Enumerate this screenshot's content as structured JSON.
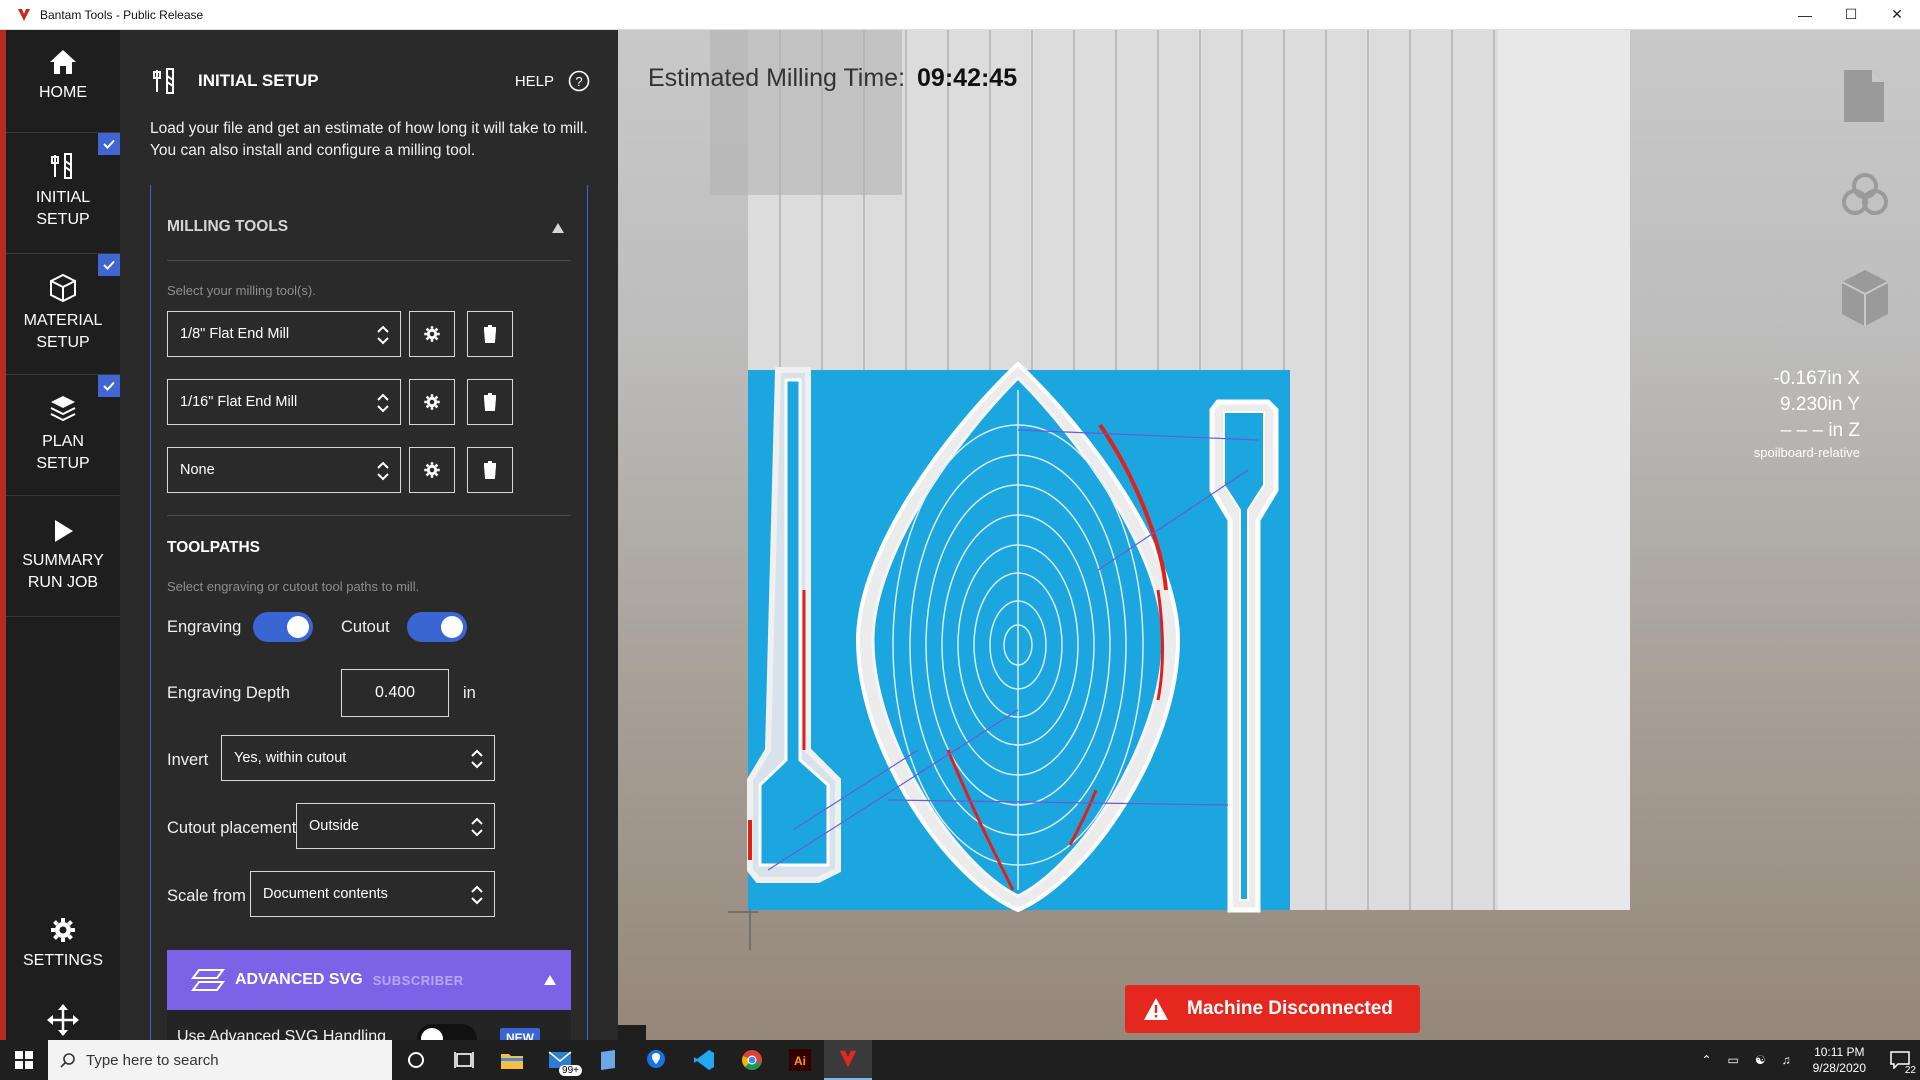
{
  "window": {
    "title": "Bantam Tools - Public Release"
  },
  "nav": {
    "home": "HOME",
    "initial_setup": [
      "INITIAL",
      "SETUP"
    ],
    "material_setup": [
      "MATERIAL",
      "SETUP"
    ],
    "plan_setup": [
      "PLAN",
      "SETUP"
    ],
    "summary": [
      "SUMMARY",
      "RUN JOB"
    ],
    "settings": "SETTINGS"
  },
  "panel": {
    "title": "INITIAL SETUP",
    "help": "HELP",
    "description": "Load your file and get an estimate of how long it will take to mill. You can also install and configure a milling tool.",
    "milling_tools": {
      "title": "MILLING TOOLS",
      "hint": "Select your milling tool(s).",
      "tools": [
        "1/8\" Flat End Mill",
        "1/16\" Flat End Mill",
        "None"
      ]
    },
    "toolpaths": {
      "title": "TOOLPATHS",
      "hint": "Select engraving or cutout tool paths to mill.",
      "engraving_label": "Engraving",
      "engraving_on": true,
      "cutout_label": "Cutout",
      "cutout_on": true,
      "depth_label": "Engraving Depth",
      "depth_value": "0.400",
      "depth_unit": "in",
      "invert_label": "Invert",
      "invert_value": "Yes, within cutout",
      "placement_label": "Cutout placement",
      "placement_value": "Outside",
      "scale_label": "Scale from",
      "scale_value": "Document contents"
    },
    "advanced_svg": {
      "title": "ADVANCED SVG",
      "tag": "SUBSCRIBER",
      "use_label": "Use Advanced SVG Handling",
      "use_on": false,
      "badge": "NEW"
    }
  },
  "viewport": {
    "est_label": "Estimated Milling Time:",
    "est_value": "09:42:45",
    "coord_x": "-0.167in X",
    "coord_y": "9.230in Y",
    "coord_z": "– – – in Z",
    "coord_mode": "spoilboard-relative",
    "status": "Machine Disconnected"
  },
  "taskbar": {
    "search_placeholder": "Type here to search",
    "mail_badge": "99+",
    "time": "10:11 PM",
    "date": "9/28/2020",
    "notif_count": "22"
  },
  "colors": {
    "accent": "#3a66d4",
    "advanced": "#7b63e8",
    "alert": "#e5281f",
    "material": "#1ba6e0"
  }
}
